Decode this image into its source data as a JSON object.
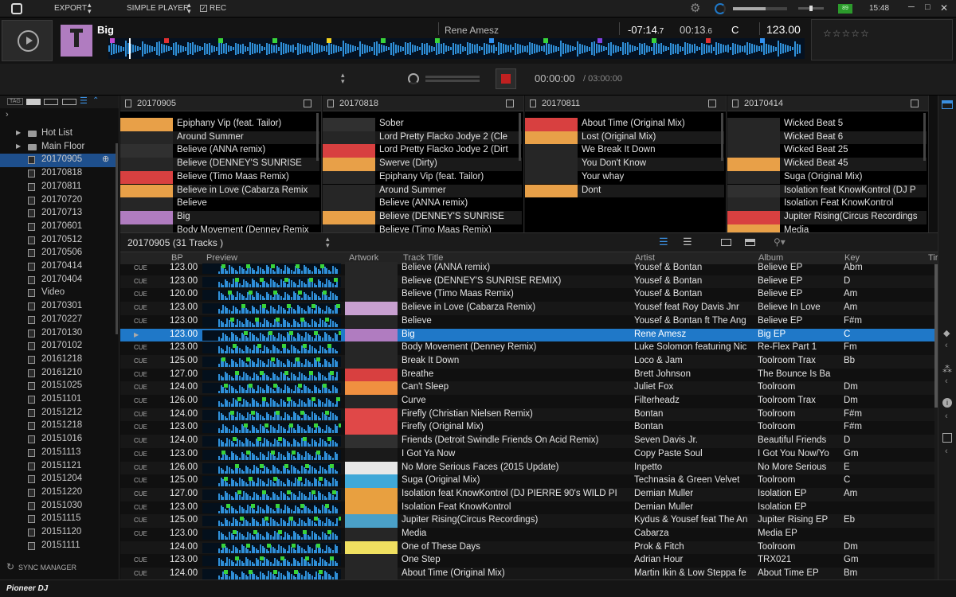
{
  "topbar": {
    "export_label": "EXPORT",
    "player_label": "SIMPLE PLAYER",
    "rec_label": "REC",
    "battery_label": "89",
    "clock": "15:48"
  },
  "deck": {
    "track_title": "Big",
    "artist": "Rene Amesz",
    "remaining": "-07:14",
    "remaining_frac": ".7",
    "elapsed": "00:13",
    "elapsed_frac": ".6",
    "key": "C",
    "bpm": "123.00",
    "rating": "☆☆☆☆☆",
    "progress": 0.03
  },
  "transport": {
    "rec_time": "00:00:00",
    "rec_total": "/ 03:00:00"
  },
  "sidebar": {
    "tag_label": "TAG",
    "items": [
      {
        "label": "Hot List",
        "type": "folder"
      },
      {
        "label": "Main Floor",
        "type": "folder"
      },
      {
        "label": "20170905",
        "type": "list",
        "selected": true
      },
      {
        "label": "20170818",
        "type": "list"
      },
      {
        "label": "20170811",
        "type": "list"
      },
      {
        "label": "20170720",
        "type": "list"
      },
      {
        "label": "20170713",
        "type": "list"
      },
      {
        "label": "20170601",
        "type": "list"
      },
      {
        "label": "20170512",
        "type": "list"
      },
      {
        "label": "20170506",
        "type": "list"
      },
      {
        "label": "20170414",
        "type": "list"
      },
      {
        "label": "20170404",
        "type": "list"
      },
      {
        "label": "Video",
        "type": "list"
      },
      {
        "label": "20170301",
        "type": "list"
      },
      {
        "label": "20170227",
        "type": "list"
      },
      {
        "label": "20170130",
        "type": "list"
      },
      {
        "label": "20170102",
        "type": "list"
      },
      {
        "label": "20161218",
        "type": "list"
      },
      {
        "label": "20161210",
        "type": "list"
      },
      {
        "label": "20151025",
        "type": "list"
      },
      {
        "label": "20151101",
        "type": "list"
      },
      {
        "label": "20151212",
        "type": "list"
      },
      {
        "label": "20151218",
        "type": "list"
      },
      {
        "label": "20151016",
        "type": "list"
      },
      {
        "label": "20151113",
        "type": "list"
      },
      {
        "label": "20151121",
        "type": "list"
      },
      {
        "label": "20151204",
        "type": "list"
      },
      {
        "label": "20151220",
        "type": "list"
      },
      {
        "label": "20151030",
        "type": "list"
      },
      {
        "label": "20151115",
        "type": "list"
      },
      {
        "label": "20151120",
        "type": "list"
      },
      {
        "label": "20151111",
        "type": "list"
      }
    ],
    "sync_label": "SYNC MANAGER"
  },
  "footer": {
    "brand": "Pioneer DJ"
  },
  "preview_columns": [
    {
      "title": "20170905",
      "tracks": [
        "Epiphany Vip (feat. Tailor)",
        "Around Summer",
        "Believe (ANNA remix)",
        "Believe (DENNEY'S SUNRISE",
        "Believe (Timo Maas Remix)",
        "Believe in Love (Cabarza Remix",
        "Believe",
        "Big",
        "Body Movement (Denney Remix"
      ]
    },
    {
      "title": "20170818",
      "tracks": [
        "Sober",
        "Lord Pretty Flacko Jodye 2 (Cle",
        "Lord Pretty Flacko Jodye 2 (Dirt",
        "Swerve (Dirty)",
        "Epiphany Vip (feat. Tailor)",
        "Around Summer",
        "Believe (ANNA remix)",
        "Believe (DENNEY'S SUNRISE",
        "Believe (Timo Maas Remix)"
      ]
    },
    {
      "title": "20170811",
      "tracks": [
        "About Time (Original Mix)",
        "Lost (Original Mix)",
        "We Break It Down",
        "You Don't Know",
        "Your whay",
        "Dont"
      ]
    },
    {
      "title": "20170414",
      "tracks": [
        "Wicked Beat 5",
        "Wicked Beat 6",
        "Wicked Beat 25",
        "Wicked Beat 45",
        "Suga (Original Mix)",
        "Isolation feat KnowKontrol (DJ P",
        "Isolation Feat KnowKontrol",
        "Jupiter Rising(Circus Recordings",
        "Media"
      ]
    }
  ],
  "tracklist": {
    "title": "20170905 (31 Tracks )",
    "columns": [
      "BP",
      "Preview",
      "Artwork",
      "Track Title",
      "Artist",
      "Album",
      "Key",
      "Tir"
    ],
    "rows": [
      {
        "cue": "CUE",
        "bpm": "123.00",
        "title": "Believe (ANNA remix)",
        "artist": "Yousef & Bontan",
        "album": "Believe EP",
        "key": "Abm",
        "art": "#262626"
      },
      {
        "cue": "CUE",
        "bpm": "123.00",
        "title": "Believe (DENNEY'S SUNRISE REMIX)",
        "artist": "Yousef & Bontan",
        "album": "Believe EP",
        "key": "D",
        "art": "#262626"
      },
      {
        "cue": "CUE",
        "bpm": "120.00",
        "title": "Believe (Timo Maas Remix)",
        "artist": "Yousef & Bontan",
        "album": "Believe EP",
        "key": "Am",
        "art": "#262626"
      },
      {
        "cue": "CUE",
        "bpm": "123.00",
        "title": "Believe in Love (Cabarza Remix)",
        "artist": "Yousef feat Roy Davis Jnr",
        "album": "Believe In Love",
        "key": "Am",
        "art": "#c8a0d0"
      },
      {
        "cue": "CUE",
        "bpm": "123.00",
        "title": "Believe",
        "artist": "Yousef & Bontan ft The Ang",
        "album": "Believe EP",
        "key": "F#m",
        "art": "#262626"
      },
      {
        "cue": "▶",
        "bpm": "123.00",
        "title": "Big",
        "artist": "Rene Amesz",
        "album": "Big EP",
        "key": "C",
        "art": "#b07cc0",
        "selected": true
      },
      {
        "cue": "CUE",
        "bpm": "123.00",
        "title": "Body Movement (Denney Remix)",
        "artist": "Luke Solomon featuring Nic",
        "album": "Re-Flex Part 1",
        "key": "Fm",
        "art": "#262626"
      },
      {
        "cue": "CUE",
        "bpm": "125.00",
        "title": "Break It Down",
        "artist": "Loco & Jam",
        "album": "Toolroom Trax",
        "key": "Bb",
        "art": "#262626"
      },
      {
        "cue": "CUE",
        "bpm": "127.00",
        "title": "Breathe",
        "artist": "Brett Johnson",
        "album": "The Bounce Is Ba",
        "key": "",
        "art": "#d84040"
      },
      {
        "cue": "CUE",
        "bpm": "124.00",
        "title": "Can't Sleep",
        "artist": "Juliet Fox",
        "album": "Toolroom",
        "key": "Dm",
        "art": "#f09040"
      },
      {
        "cue": "CUE",
        "bpm": "126.00",
        "title": "Curve",
        "artist": "Filterheadz",
        "album": "Toolroom Trax",
        "key": "Dm",
        "art": "#262626"
      },
      {
        "cue": "CUE",
        "bpm": "124.00",
        "title": "Firefly (Christian Nielsen Remix)",
        "artist": "Bontan",
        "album": "Toolroom",
        "key": "F#m",
        "art": "#e04848"
      },
      {
        "cue": "CUE",
        "bpm": "123.00",
        "title": "Firefly (Original Mix)",
        "artist": "Bontan",
        "album": "Toolroom",
        "key": "F#m",
        "art": "#e04848"
      },
      {
        "cue": "CUE",
        "bpm": "124.00",
        "title": "Friends (Detroit Swindle Friends On Acid Remix)",
        "artist": "Seven Davis Jr.",
        "album": "Beautiful Friends",
        "key": "D",
        "art": "#303030"
      },
      {
        "cue": "CUE",
        "bpm": "123.00",
        "title": "I Got Ya Now",
        "artist": "Copy Paste Soul",
        "album": "I Got You Now/Yo",
        "key": "Gm",
        "art": "#1a1a1a"
      },
      {
        "cue": "CUE",
        "bpm": "126.00",
        "title": "No More Serious Faces (2015 Update)",
        "artist": "Inpetto",
        "album": "No More Serious",
        "key": "E",
        "art": "#e8e8e8"
      },
      {
        "cue": "CUE",
        "bpm": "125.00",
        "title": "Suga (Original Mix)",
        "artist": "Technasia & Green Velvet",
        "album": "Toolroom",
        "key": "C",
        "art": "#40a8d8"
      },
      {
        "cue": "CUE",
        "bpm": "127.00",
        "title": "Isolation feat KnowKontrol (DJ PIERRE 90's WILD PI",
        "artist": "Demian Muller",
        "album": "Isolation EP",
        "key": "Am",
        "art": "#e8a040"
      },
      {
        "cue": "CUE",
        "bpm": "123.00",
        "title": "Isolation Feat KnowKontrol",
        "artist": "Demian Muller",
        "album": "Isolation EP",
        "key": "",
        "art": "#e8a040"
      },
      {
        "cue": "CUE",
        "bpm": "125.00",
        "title": "Jupiter Rising(Circus Recordings)",
        "artist": "Kydus & Yousef feat The An",
        "album": "Jupiter Rising EP",
        "key": "Eb",
        "art": "#4aa0c8"
      },
      {
        "cue": "CUE",
        "bpm": "123.00",
        "title": "Media",
        "artist": "Cabarza",
        "album": "Media EP",
        "key": "",
        "art": "#262626"
      },
      {
        "cue": "",
        "bpm": "124.00",
        "title": "One of These Days",
        "artist": "Prok & Fitch",
        "album": "Toolroom",
        "key": "Dm",
        "art": "#f0e060"
      },
      {
        "cue": "CUE",
        "bpm": "123.00",
        "title": "One Step",
        "artist": "Adrian Hour",
        "album": "TRX021",
        "key": "Gm",
        "art": "#262626"
      },
      {
        "cue": "CUE",
        "bpm": "124.00",
        "title": "About Time (Original Mix)",
        "artist": "Martin Ikin & Low Steppa fe",
        "album": "About Time EP",
        "key": "Bm",
        "art": "#262626"
      }
    ]
  },
  "colors": {
    "accent": "#1f78c8",
    "waveform": "#2f8fd8",
    "cue_marker": "#39d339",
    "rec": "#c02020"
  }
}
